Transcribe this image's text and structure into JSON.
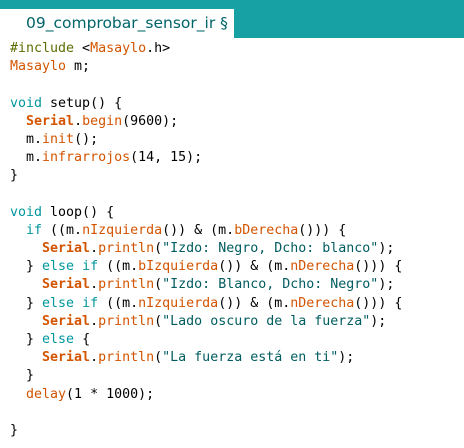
{
  "tab": {
    "title": "09_comprobar_sensor_ir §"
  },
  "colors": {
    "tabbar": "#17a1a5",
    "tab_text": "#006468",
    "keyword": "#00979c",
    "function": "#d35400",
    "string": "#005c5f",
    "include": "#5e6d03"
  },
  "code_lines": [
    [
      [
        "inc",
        "#include"
      ],
      [
        "plain",
        " <"
      ],
      [
        "fn",
        "Masaylo"
      ],
      [
        "plain",
        ".h>"
      ]
    ],
    [
      [
        "fn",
        "Masaylo"
      ],
      [
        "plain",
        " m;"
      ]
    ],
    [],
    [
      [
        "kw",
        "void"
      ],
      [
        "plain",
        " setup() {"
      ]
    ],
    [
      [
        "plain",
        "  "
      ],
      [
        "cls",
        "Serial"
      ],
      [
        "plain",
        "."
      ],
      [
        "fn",
        "begin"
      ],
      [
        "plain",
        "(9600);"
      ]
    ],
    [
      [
        "plain",
        "  m."
      ],
      [
        "fn",
        "init"
      ],
      [
        "plain",
        "();"
      ]
    ],
    [
      [
        "plain",
        "  m."
      ],
      [
        "fn",
        "infrarrojos"
      ],
      [
        "plain",
        "(14, 15);"
      ]
    ],
    [
      [
        "plain",
        "}"
      ]
    ],
    [],
    [
      [
        "kw",
        "void"
      ],
      [
        "plain",
        " loop() {"
      ]
    ],
    [
      [
        "plain",
        "  "
      ],
      [
        "kw",
        "if"
      ],
      [
        "plain",
        " ((m."
      ],
      [
        "fn",
        "nIzquierda"
      ],
      [
        "plain",
        "()) & (m."
      ],
      [
        "fn",
        "bDerecha"
      ],
      [
        "plain",
        "())) {"
      ]
    ],
    [
      [
        "plain",
        "    "
      ],
      [
        "cls",
        "Serial"
      ],
      [
        "plain",
        "."
      ],
      [
        "fn",
        "println"
      ],
      [
        "plain",
        "("
      ],
      [
        "str",
        "\"Izdo: Negro, Dcho: blanco\""
      ],
      [
        "plain",
        ");"
      ]
    ],
    [
      [
        "plain",
        "  } "
      ],
      [
        "kw",
        "else"
      ],
      [
        "plain",
        " "
      ],
      [
        "kw",
        "if"
      ],
      [
        "plain",
        " ((m."
      ],
      [
        "fn",
        "bIzquierda"
      ],
      [
        "plain",
        "()) & (m."
      ],
      [
        "fn",
        "nDerecha"
      ],
      [
        "plain",
        "())) {"
      ]
    ],
    [
      [
        "plain",
        "    "
      ],
      [
        "cls",
        "Serial"
      ],
      [
        "plain",
        "."
      ],
      [
        "fn",
        "println"
      ],
      [
        "plain",
        "("
      ],
      [
        "str",
        "\"Izdo: Blanco, Dcho: Negro\""
      ],
      [
        "plain",
        ");"
      ]
    ],
    [
      [
        "plain",
        "  } "
      ],
      [
        "kw",
        "else"
      ],
      [
        "plain",
        " "
      ],
      [
        "kw",
        "if"
      ],
      [
        "plain",
        " ((m."
      ],
      [
        "fn",
        "nIzquierda"
      ],
      [
        "plain",
        "()) & (m."
      ],
      [
        "fn",
        "nDerecha"
      ],
      [
        "plain",
        "())) {"
      ]
    ],
    [
      [
        "plain",
        "    "
      ],
      [
        "cls",
        "Serial"
      ],
      [
        "plain",
        "."
      ],
      [
        "fn",
        "println"
      ],
      [
        "plain",
        "("
      ],
      [
        "str",
        "\"Lado oscuro de la fuerza\""
      ],
      [
        "plain",
        ");"
      ]
    ],
    [
      [
        "plain",
        "  } "
      ],
      [
        "kw",
        "else"
      ],
      [
        "plain",
        " {"
      ]
    ],
    [
      [
        "plain",
        "    "
      ],
      [
        "cls",
        "Serial"
      ],
      [
        "plain",
        "."
      ],
      [
        "fn",
        "println"
      ],
      [
        "plain",
        "("
      ],
      [
        "str",
        "\"La fuerza está en ti\""
      ],
      [
        "plain",
        ");"
      ]
    ],
    [
      [
        "plain",
        "  }"
      ]
    ],
    [
      [
        "plain",
        "  "
      ],
      [
        "fn",
        "delay"
      ],
      [
        "plain",
        "(1 * 1000);"
      ]
    ],
    [],
    [
      [
        "plain",
        "}"
      ]
    ]
  ]
}
